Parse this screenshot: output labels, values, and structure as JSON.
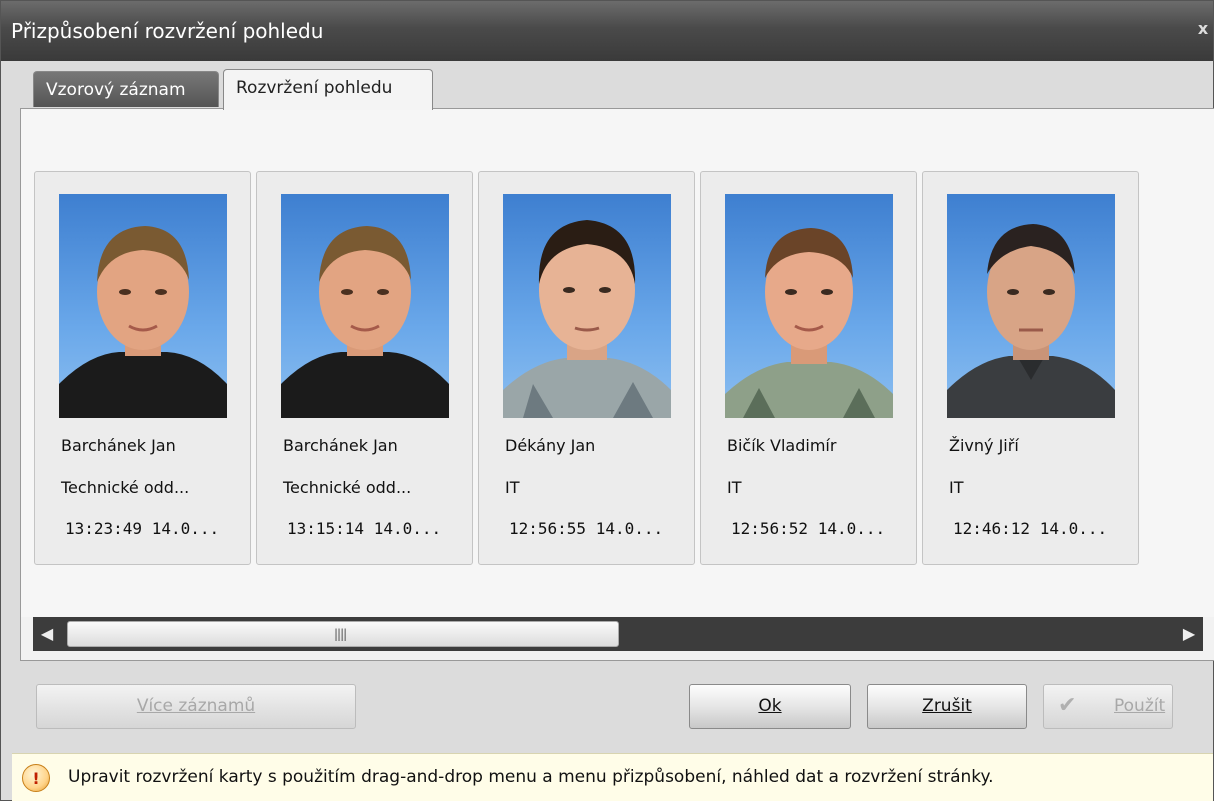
{
  "window": {
    "title": "Přizpůsobení rozvržení pohledu",
    "close_label": "x"
  },
  "tabs": [
    {
      "label": "Vzorový záznam",
      "active": false
    },
    {
      "label": "Rozvržení pohledu",
      "active": true
    }
  ],
  "cards": [
    {
      "name": "Barchánek Jan",
      "department": "Technické odd...",
      "time": "13:23:49 14.0..."
    },
    {
      "name": "Barchánek Jan",
      "department": "Technické odd...",
      "time": "13:15:14 14.0..."
    },
    {
      "name": "Dékány Jan",
      "department": "IT",
      "time": "12:56:55 14.0..."
    },
    {
      "name": "Bičík Vladimír",
      "department": "IT",
      "time": "12:56:52 14.0..."
    },
    {
      "name": "Živný Jiří",
      "department": "IT",
      "time": "12:46:12 14.0..."
    }
  ],
  "scrollbar": {
    "left_arrow": "◀",
    "right_arrow": "▶",
    "grip": "||||",
    "position": 0
  },
  "buttons": {
    "more_label": "Více záznamů",
    "ok_label": "Ok",
    "cancel_label": "Zrušit",
    "apply_label": "Použít"
  },
  "status": {
    "icon": "!",
    "text": "Upravit rozvržení karty s použitím drag-and-drop menu a menu přizpůsobení, náhled dat a rozvržení stránky."
  },
  "colors": {
    "titlebar": "#4a4a4a",
    "photo_background": "#5a9be0",
    "status_background": "#fffde8"
  }
}
